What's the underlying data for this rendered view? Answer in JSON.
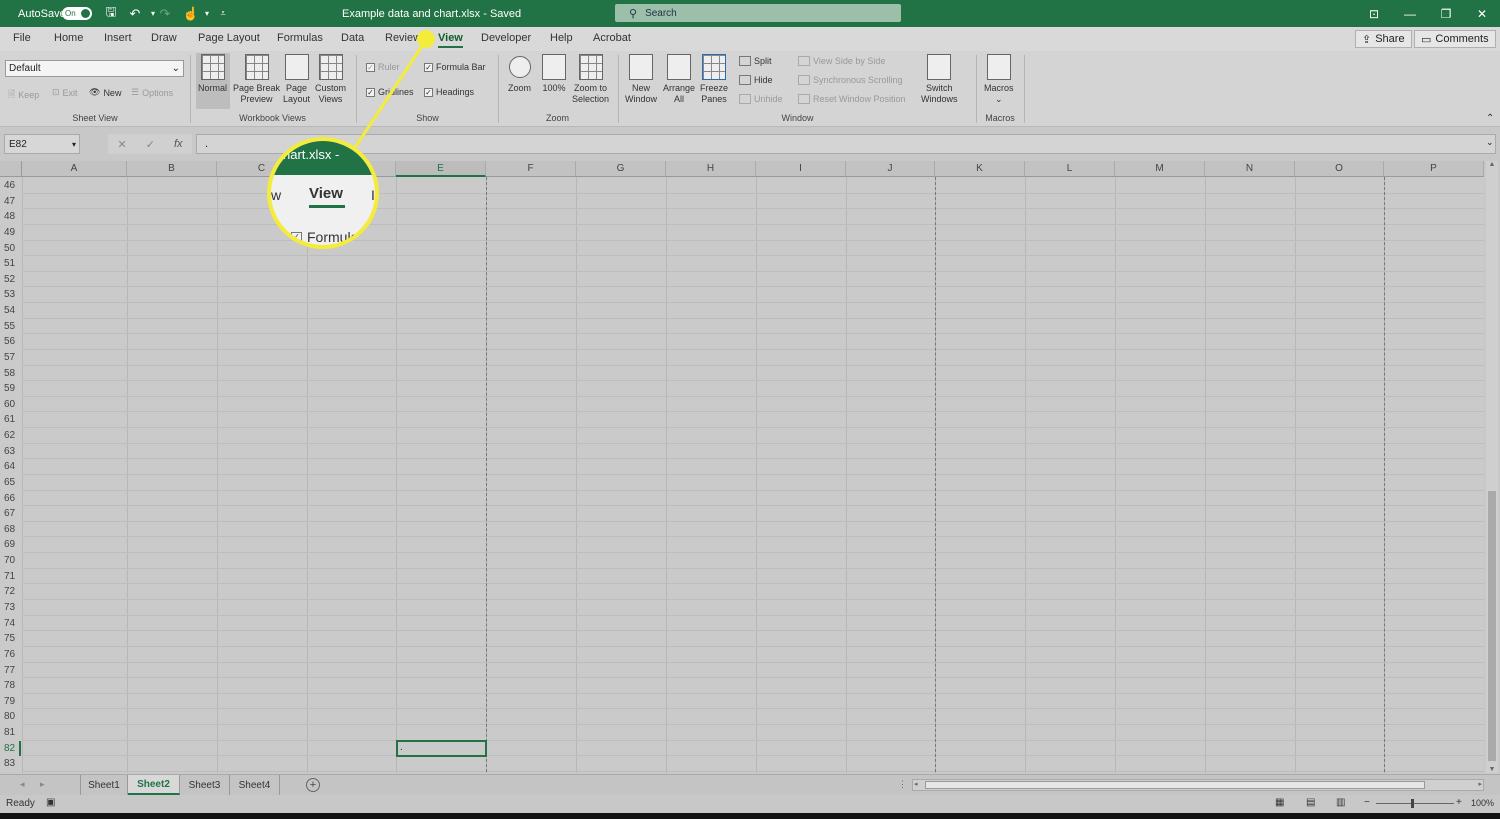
{
  "titlebar": {
    "autosave_label": "AutoSave",
    "autosave_state": "On",
    "doc_title": "Example data and chart.xlsx  -  Saved",
    "search_placeholder": "Search",
    "bg_color": "#217346"
  },
  "tabs": [
    "File",
    "Home",
    "Insert",
    "Draw",
    "Page Layout",
    "Formulas",
    "Data",
    "Review",
    "View",
    "Developer",
    "Help",
    "Acrobat"
  ],
  "active_tab": "View",
  "share_label": "Share",
  "comments_label": "Comments",
  "ribbon": {
    "sheet_view": {
      "select_value": "Default",
      "keep": "Keep",
      "exit": "Exit",
      "new": "New",
      "options": "Options",
      "label": "Sheet View"
    },
    "workbook_views": {
      "normal": "Normal",
      "page_break_1": "Page Break",
      "page_break_2": "Preview",
      "page_layout_1": "Page",
      "page_layout_2": "Layout",
      "custom_1": "Custom",
      "custom_2": "Views",
      "label": "Workbook Views"
    },
    "show": {
      "ruler": "Ruler",
      "formula_bar": "Formula Bar",
      "gridlines": "Gridlines",
      "headings": "Headings",
      "label": "Show"
    },
    "zoom": {
      "zoom": "Zoom",
      "hundred": "100%",
      "zoom_sel_1": "Zoom to",
      "zoom_sel_2": "Selection",
      "label": "Zoom"
    },
    "window": {
      "new_1": "New",
      "new_2": "Window",
      "arrange_1": "Arrange",
      "arrange_2": "All",
      "freeze_1": "Freeze",
      "freeze_2": "Panes",
      "split": "Split",
      "hide": "Hide",
      "unhide": "Unhide",
      "side_by_side": "View Side by Side",
      "sync_scroll": "Synchronous Scrolling",
      "reset_pos": "Reset Window Position",
      "switch_1": "Switch",
      "switch_2": "Windows",
      "label": "Window"
    },
    "macros": {
      "macros": "Macros",
      "label": "Macros"
    }
  },
  "formula_bar": {
    "name_box": "E82",
    "content": "."
  },
  "grid": {
    "columns": [
      "A",
      "B",
      "C",
      "D",
      "E",
      "F",
      "G",
      "H",
      "I",
      "J",
      "K",
      "L",
      "M",
      "N",
      "O",
      "P"
    ],
    "rows": [
      "46",
      "47",
      "48",
      "49",
      "50",
      "51",
      "52",
      "53",
      "54",
      "55",
      "56",
      "57",
      "58",
      "59",
      "60",
      "61",
      "62",
      "63",
      "64",
      "65",
      "66",
      "67",
      "68",
      "69",
      "70",
      "71",
      "72",
      "73",
      "74",
      "75",
      "76",
      "77",
      "78",
      "79",
      "80",
      "81",
      "82",
      "83"
    ],
    "selected_column": "E",
    "selected_row": "82",
    "active_cell_value": "."
  },
  "sheets": [
    "Sheet1",
    "Sheet2",
    "Sheet3",
    "Sheet4"
  ],
  "active_sheet": "Sheet2",
  "status": {
    "ready": "Ready",
    "zoom": "100%"
  },
  "callout": {
    "top_text": "hart.xlsx  -  ",
    "left_fragment": "w",
    "view": "View",
    "right_fragment": "I",
    "formula_fragment": "Formula",
    "color": "#f4ec3a"
  }
}
